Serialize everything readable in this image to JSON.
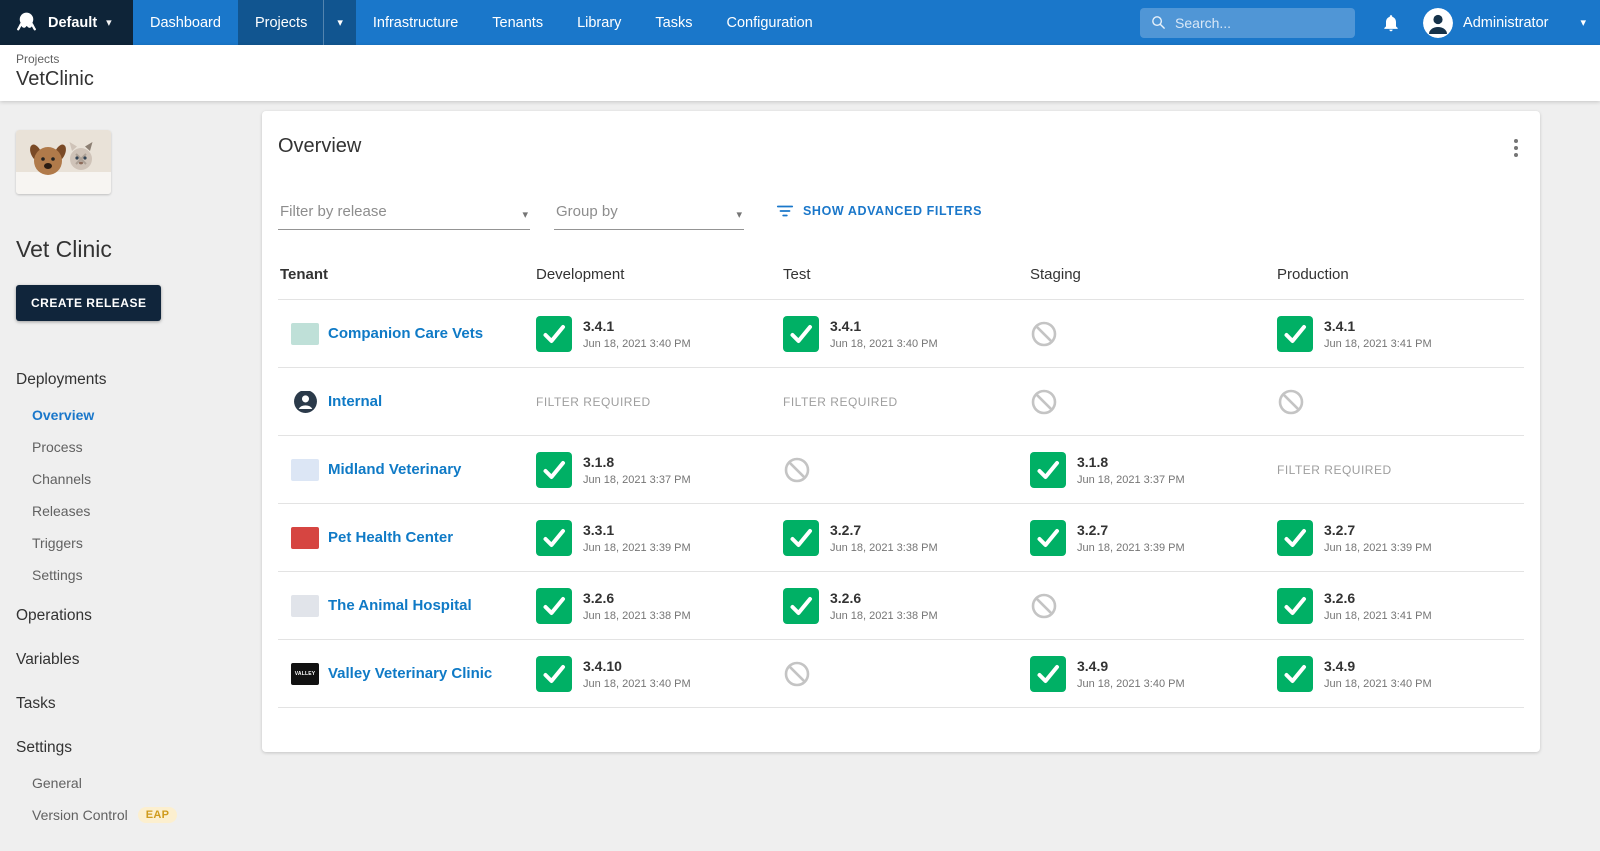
{
  "colors": {
    "nav_blue": "#1a77ca",
    "nav_active_blue": "#115590",
    "space_dark_navy": "#0e2438",
    "success_green": "#00b065",
    "link_blue": "#0f7ac6",
    "eap_badge_bg": "#fcefcf",
    "eap_badge_text": "#cf9b1d"
  },
  "topbar": {
    "space_label": "Default",
    "nav": [
      {
        "label": "Dashboard",
        "active": false
      },
      {
        "label": "Projects",
        "active": true,
        "has_caret": true
      },
      {
        "label": "Infrastructure",
        "active": false
      },
      {
        "label": "Tenants",
        "active": false
      },
      {
        "label": "Library",
        "active": false
      },
      {
        "label": "Tasks",
        "active": false
      },
      {
        "label": "Configuration",
        "active": false
      }
    ],
    "search_placeholder": "Search...",
    "user_name": "Administrator"
  },
  "breadcrumb": {
    "section": "Projects",
    "page": "VetClinic"
  },
  "sidebar": {
    "project_name": "Vet Clinic",
    "create_release_label": "CREATE RELEASE",
    "nav": [
      {
        "label": "Deployments",
        "children": [
          {
            "label": "Overview",
            "active": true
          },
          {
            "label": "Process"
          },
          {
            "label": "Channels"
          },
          {
            "label": "Releases"
          },
          {
            "label": "Triggers"
          },
          {
            "label": "Settings"
          }
        ]
      },
      {
        "label": "Operations",
        "children": []
      },
      {
        "label": "Variables",
        "children": []
      },
      {
        "label": "Tasks",
        "children": []
      },
      {
        "label": "Settings",
        "children": [
          {
            "label": "General"
          },
          {
            "label": "Version Control",
            "badge": "EAP"
          }
        ]
      }
    ]
  },
  "overview": {
    "title": "Overview",
    "filter_by_release_placeholder": "Filter by release",
    "group_by_placeholder": "Group by",
    "advanced_filters_label": "SHOW ADVANCED FILTERS",
    "filter_required_label": "FILTER REQUIRED",
    "columns": [
      "Tenant",
      "Development",
      "Test",
      "Staging",
      "Production"
    ],
    "rows": [
      {
        "tenant": "Companion Care Vets",
        "logo": {
          "type": "box",
          "bg": "#bfe0d8",
          "fg": "#3a7a63",
          "label": ""
        },
        "cells": [
          {
            "status": "success",
            "version": "3.4.1",
            "date": "Jun 18, 2021 3:40 PM"
          },
          {
            "status": "success",
            "version": "3.4.1",
            "date": "Jun 18, 2021 3:40 PM"
          },
          {
            "status": "blocked"
          },
          {
            "status": "success",
            "version": "3.4.1",
            "date": "Jun 18, 2021 3:41 PM"
          }
        ]
      },
      {
        "tenant": "Internal",
        "logo": {
          "type": "person"
        },
        "cells": [
          {
            "status": "filter_required"
          },
          {
            "status": "filter_required"
          },
          {
            "status": "blocked"
          },
          {
            "status": "blocked"
          }
        ]
      },
      {
        "tenant": "Midland Veterinary",
        "logo": {
          "type": "box",
          "bg": "#dce6f5",
          "fg": "#2c4a8c",
          "label": ""
        },
        "cells": [
          {
            "status": "success",
            "version": "3.1.8",
            "date": "Jun 18, 2021 3:37 PM"
          },
          {
            "status": "blocked"
          },
          {
            "status": "success",
            "version": "3.1.8",
            "date": "Jun 18, 2021 3:37 PM"
          },
          {
            "status": "filter_required"
          }
        ]
      },
      {
        "tenant": "Pet Health Center",
        "logo": {
          "type": "box",
          "bg": "#d64541",
          "fg": "#ffffff",
          "label": ""
        },
        "cells": [
          {
            "status": "success",
            "version": "3.3.1",
            "date": "Jun 18, 2021 3:39 PM"
          },
          {
            "status": "success",
            "version": "3.2.7",
            "date": "Jun 18, 2021 3:38 PM"
          },
          {
            "status": "success",
            "version": "3.2.7",
            "date": "Jun 18, 2021 3:39 PM"
          },
          {
            "status": "success",
            "version": "3.2.7",
            "date": "Jun 18, 2021 3:39 PM"
          }
        ]
      },
      {
        "tenant": "The Animal Hospital",
        "logo": {
          "type": "box",
          "bg": "#e1e4ea",
          "fg": "#5a6b80",
          "label": ""
        },
        "cells": [
          {
            "status": "success",
            "version": "3.2.6",
            "date": "Jun 18, 2021 3:38 PM"
          },
          {
            "status": "success",
            "version": "3.2.6",
            "date": "Jun 18, 2021 3:38 PM"
          },
          {
            "status": "blocked"
          },
          {
            "status": "success",
            "version": "3.2.6",
            "date": "Jun 18, 2021 3:41 PM"
          }
        ]
      },
      {
        "tenant": "Valley Veterinary Clinic",
        "logo": {
          "type": "box",
          "bg": "#111111",
          "fg": "#ffffff",
          "label": "VALLEY"
        },
        "cells": [
          {
            "status": "success",
            "version": "3.4.10",
            "date": "Jun 18, 2021 3:40 PM"
          },
          {
            "status": "blocked"
          },
          {
            "status": "success",
            "version": "3.4.9",
            "date": "Jun 18, 2021 3:40 PM"
          },
          {
            "status": "success",
            "version": "3.4.9",
            "date": "Jun 18, 2021 3:40 PM"
          }
        ]
      }
    ]
  }
}
